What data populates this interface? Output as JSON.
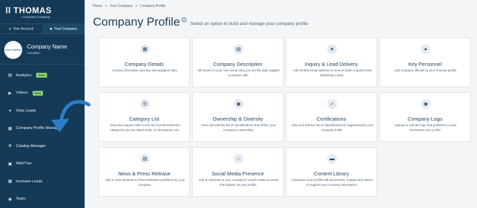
{
  "brand": {
    "name": "THOMAS",
    "tagline": "A Xometry Company"
  },
  "account_tabs": [
    {
      "label": "Your Account",
      "icon": "person-icon",
      "active": false
    },
    {
      "label": "Your Company",
      "icon": "building-icon",
      "active": true
    }
  ],
  "company": {
    "avatar_text": "YOUR COMPANY",
    "name": "Company Name",
    "location": "Location"
  },
  "nav": [
    {
      "label": "Analytics",
      "icon": "document-icon",
      "badge": "Beta"
    },
    {
      "label": "Videos",
      "icon": "video-icon",
      "badge": "Beta"
    },
    {
      "label": "View Leads",
      "icon": "person-icon",
      "badge": ""
    },
    {
      "label": "Company Profile Manager",
      "icon": "building-icon",
      "badge": ""
    },
    {
      "label": "Catalog Manager",
      "icon": "gear-icon",
      "badge": ""
    },
    {
      "label": "WebTrax",
      "icon": "monitor-icon",
      "badge": ""
    },
    {
      "label": "Increase Leads",
      "icon": "chart-icon",
      "badge": ""
    },
    {
      "label": "Team",
      "icon": "team-icon",
      "badge": ""
    }
  ],
  "breadcrumb": [
    "Home",
    ">",
    "Your Company",
    ">",
    "Company Profile"
  ],
  "header": {
    "title": "Company Profile",
    "help": "?",
    "subtitle": "Select an option to build and manage your company profile"
  },
  "cards": [
    {
      "title": "Company Details",
      "icon": "building-icon",
      "desc": "Contact information and key demographic data."
    },
    {
      "title": "Company Description",
      "icon": "document-icon",
      "desc": "Tell buyers in your own words why you are the right supplier to partner with."
    },
    {
      "title": "Inquiry & Lead Delivery",
      "icon": "paper-plane-icon",
      "desc": "Add verified email address to receive Sales Inquiries and Marketing Leads."
    },
    {
      "title": "Key Personnel",
      "icon": "people-icon",
      "desc": "Add company officials to your Thomas profile."
    },
    {
      "title": "Category List",
      "icon": "list-icon",
      "desc": "View and request edits to the list of product/service categories you are listed under on thomasnet.com."
    },
    {
      "title": "Ownership & Diversity",
      "icon": "team-icon",
      "desc": "View and edit the list of classifications that define your company's ownership."
    },
    {
      "title": "Certifications",
      "icon": "certificate-icon",
      "desc": "View and edit the list of classification(s)/ registration(s) your company holds."
    },
    {
      "title": "Company Logo",
      "icon": "camera-icon",
      "desc": "Upload or edit the logo that publishes to your thomasnet.com profile."
    },
    {
      "title": "News & Press Release",
      "icon": "newspaper-icon",
      "desc": "Add or view all News & Press Releases published by your company."
    },
    {
      "title": "Social Media Presence",
      "icon": "share-icon",
      "desc": "Add or edit links to your company's social media accounts that appear on your profile."
    },
    {
      "title": "Content Library",
      "icon": "folder-icon",
      "desc": "Customize your profile with documents, images and videos to support your company description."
    }
  ],
  "colors": {
    "sidebar": "#143a57",
    "accent": "#2c7ec9",
    "title": "#1d3f5b",
    "badge": "#8fd16a"
  }
}
